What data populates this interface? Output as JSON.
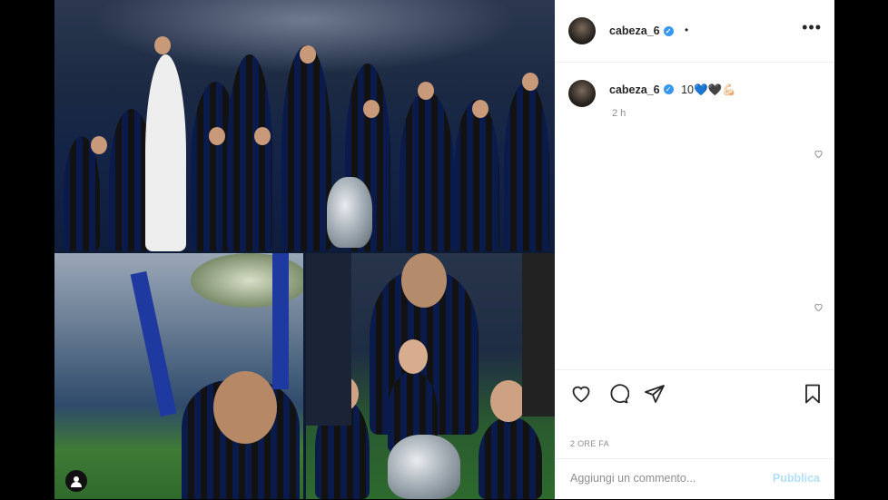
{
  "post": {
    "author": "cabeza_6",
    "separator_dot": "•",
    "more_menu": "•••"
  },
  "caption": {
    "author": "cabeza_6",
    "text": "10💙🖤💪🏻",
    "time_ago": "2 h"
  },
  "actions": {
    "like_icon": "heart-icon",
    "comment_icon": "comment-icon",
    "share_icon": "share-icon",
    "save_icon": "bookmark-icon",
    "date": "2 ORE FA"
  },
  "comment": {
    "placeholder": "Aggiungi un commento...",
    "publish_label": "Pubblica"
  },
  "colors": {
    "verified": "#3897f0",
    "publish_disabled": "#b2dffc",
    "muted_text": "#8e8e8e"
  }
}
